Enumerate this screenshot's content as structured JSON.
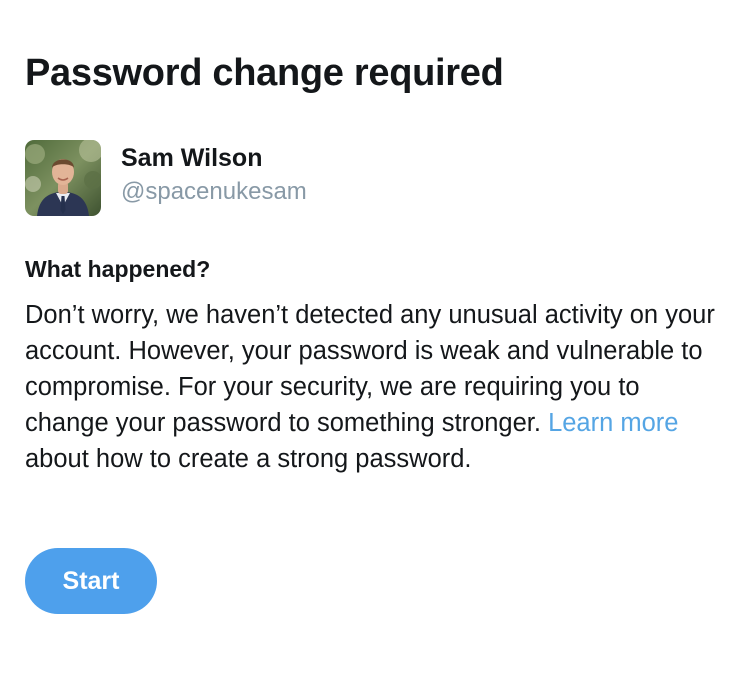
{
  "page": {
    "title": "Password change required"
  },
  "account": {
    "display_name": "Sam Wilson",
    "handle": "@spacenukesam"
  },
  "notice": {
    "heading": "What happened?",
    "body_before_link": "Don’t worry, we haven’t detected any unusual activity on your account. However, your password is weak and vulnerable to compromise. For your security, we are requiring you to change your password to something stronger. ",
    "link_label": "Learn more",
    "body_after_link": " about how to create a strong password."
  },
  "actions": {
    "start_label": "Start"
  },
  "colors": {
    "text": "#14171a",
    "secondary_text": "#8899a6",
    "link": "#55a5e4",
    "button": "#4ea0ec"
  }
}
